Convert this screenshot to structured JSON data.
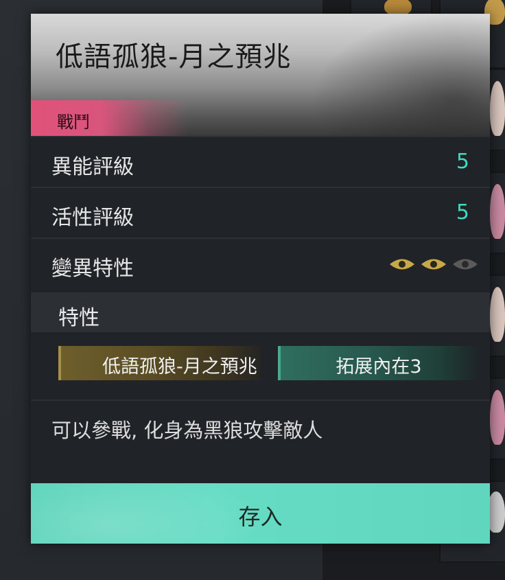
{
  "item": {
    "title": "低語孤狼-月之預兆",
    "category_tag": "戰鬥"
  },
  "stats": [
    {
      "label": "異能評級",
      "value": "5"
    },
    {
      "label": "活性評級",
      "value": "5"
    },
    {
      "label": "變異特性",
      "eyes_active": 2,
      "eyes_total": 3
    }
  ],
  "traits": {
    "heading": "特性",
    "chips": [
      {
        "label": "低語孤狼-月之預兆",
        "style": "gold"
      },
      {
        "label": "拓展內在3",
        "style": "teal"
      }
    ]
  },
  "description": "可以參戰, 化身為黑狼攻擊敵人",
  "actions": {
    "save_label": "存入"
  },
  "colors": {
    "accent_teal": "#41d9c0",
    "tag_pink": "#e0527a",
    "eye_gold": "#c9a84a",
    "eye_dim": "#5a5a5a",
    "button": "#5ad3b9"
  }
}
